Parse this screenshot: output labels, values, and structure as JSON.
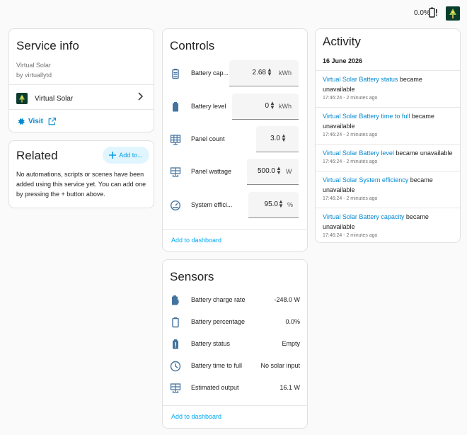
{
  "status": {
    "battery_percent": "0.0%"
  },
  "service_info": {
    "title": "Service info",
    "name": "Virtual Solar",
    "by": "by virtuallytd",
    "device": "Virtual Solar",
    "visit": "Visit"
  },
  "related": {
    "title": "Related",
    "add_label": "Add to...",
    "empty_text": "No automations, scripts or scenes have been added using this service yet. You can add one by pressing the + button above."
  },
  "controls": {
    "title": "Controls",
    "rows": [
      {
        "label": "Battery cap...",
        "value": "2.68",
        "unit": "kWh",
        "icon": "battery-capacity-icon"
      },
      {
        "label": "Battery level",
        "value": "0",
        "unit": "kWh",
        "icon": "battery-icon"
      },
      {
        "label": "Panel count",
        "value": "3.0",
        "unit": "",
        "icon": "solar-panel-icon"
      },
      {
        "label": "Panel wattage",
        "value": "500.0",
        "unit": "W",
        "icon": "solar-power-icon"
      },
      {
        "label": "System effici...",
        "value": "95.0",
        "unit": "%",
        "icon": "gauge-icon"
      }
    ],
    "add_to_dashboard": "Add to dashboard"
  },
  "sensors": {
    "title": "Sensors",
    "rows": [
      {
        "label": "Battery charge rate",
        "value": "-248.0 W",
        "icon": "battery-charging-icon"
      },
      {
        "label": "Battery percentage",
        "value": "0.0%",
        "icon": "battery-outline-icon"
      },
      {
        "label": "Battery status",
        "value": "Empty",
        "icon": "battery-alert-icon"
      },
      {
        "label": "Battery time to full",
        "value": "No solar input",
        "icon": "clock-icon"
      },
      {
        "label": "Estimated output",
        "value": "16.1 W",
        "icon": "solar-power-icon"
      }
    ],
    "add_to_dashboard": "Add to dashboard"
  },
  "activity": {
    "title": "Activity",
    "date": "16 June 2026",
    "entries": [
      {
        "entity": "Virtual Solar Battery status",
        "text": " became unavailable",
        "time": "17:46:24 - 2 minutes ago"
      },
      {
        "entity": "Virtual Solar Battery time to full",
        "text": " became unavailable",
        "time": "17:46:24 - 2 minutes ago"
      },
      {
        "entity": "Virtual Solar Battery level",
        "text": " became unavailable",
        "time": "17:46:24 - 2 minutes ago"
      },
      {
        "entity": "Virtual Solar System efficiency",
        "text": " became unavailable",
        "time": "17:46:24 - 2 minutes ago"
      },
      {
        "entity": "Virtual Solar Battery capacity",
        "text": " became unavailable",
        "time": "17:46:24 - 2 minutes ago"
      }
    ]
  }
}
